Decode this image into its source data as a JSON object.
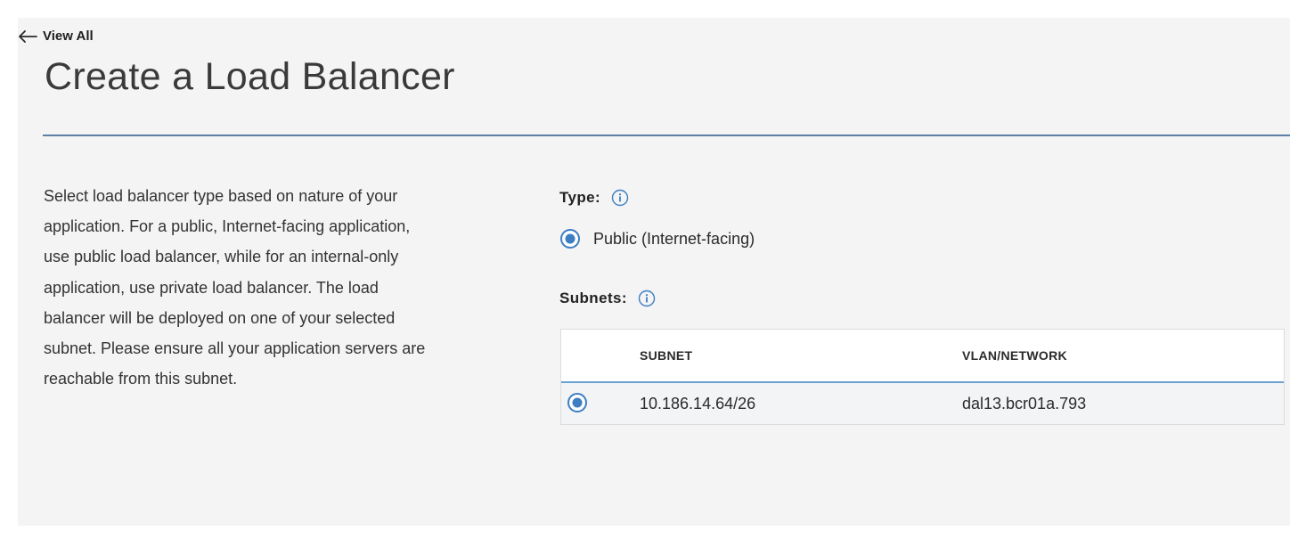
{
  "nav": {
    "back_label": "View All",
    "back_icon": "arrow-left-icon"
  },
  "page": {
    "title": "Create a Load Balancer"
  },
  "description": "Select load balancer type based on nature of your application. For a public, Internet-facing application, use public load balancer, while for an internal-only application, use private load balancer. The load balancer will be deployed on one of your selected subnet. Please ensure all your application servers are reachable from this subnet.",
  "type_field": {
    "label": "Type:",
    "info_icon": "info-icon",
    "options": [
      {
        "label": "Public (Internet-facing)",
        "selected": true
      }
    ]
  },
  "subnets_field": {
    "label": "Subnets:",
    "info_icon": "info-icon",
    "columns": [
      "SUBNET",
      "VLAN/NETWORK"
    ],
    "rows": [
      {
        "subnet": "10.186.14.64/26",
        "vlan": "dal13.bcr01a.793",
        "selected": true
      }
    ]
  },
  "colors": {
    "accent": "#3d7ec3",
    "divider": "#5b7fa6",
    "table_header_border": "#6aa2d2",
    "panel_bg": "#f4f4f4"
  }
}
